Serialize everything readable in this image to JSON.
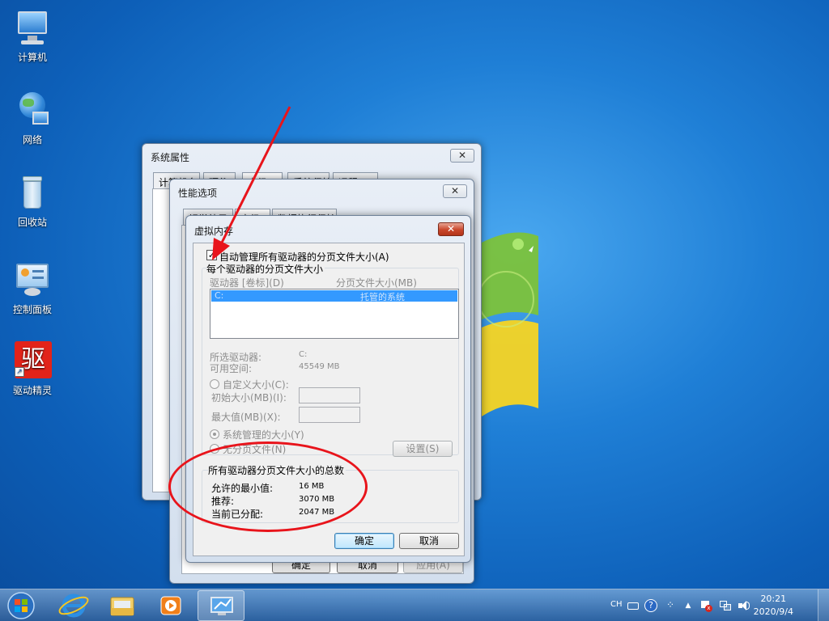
{
  "desktop": {
    "icons": [
      {
        "label": "计算机"
      },
      {
        "label": "网络"
      },
      {
        "label": "回收站"
      },
      {
        "label": "控制面板"
      },
      {
        "label": "驱动精灵",
        "glyph_text": "驱"
      }
    ]
  },
  "system_properties": {
    "title": "系统属性",
    "close": "✕",
    "tabs": [
      "计算机名",
      "硬件",
      "高级",
      "系统保护",
      "远程"
    ],
    "ok": "确定",
    "cancel": "取消",
    "apply": "应用(A)"
  },
  "performance_options": {
    "title": "性能选项",
    "close": "✕",
    "tabs": [
      "视觉效果",
      "高级",
      "数据执行保护"
    ]
  },
  "virtual_memory": {
    "title": "虚拟内存",
    "close": "✕",
    "auto_manage_label": "自动管理所有驱动器的分页文件大小(A)",
    "auto_manage_checked": true,
    "check_glyph": "✓",
    "per_drive_group": "每个驱动器的分页文件大小",
    "col_drive": "驱动器 [卷标](D)",
    "col_size": "分页文件大小(MB)",
    "drive_row": {
      "drive": "C:",
      "size": "托管的系统"
    },
    "selected_drive_label": "所选驱动器:",
    "selected_drive_value": "C:",
    "free_space_label": "可用空间:",
    "free_space_value": "45549 MB",
    "custom_size": "自定义大小(C):",
    "initial_size": "初始大小(MB)(I):",
    "max_size": "最大值(MB)(X):",
    "system_managed": "系统管理的大小(Y)",
    "no_paging": "无分页文件(N)",
    "set_button": "设置(S)",
    "totals_group": "所有驱动器分页文件大小的总数",
    "min_allowed_label": "允许的最小值:",
    "min_allowed_value": "16 MB",
    "recommended_label": "推荐:",
    "recommended_value": "3070 MB",
    "allocated_label": "当前已分配:",
    "allocated_value": "2047 MB",
    "ok": "确定",
    "cancel": "取消"
  },
  "taskbar": {
    "lang": "CH",
    "time": "20:21",
    "date": "2020/9/4"
  },
  "colors": {
    "annotation": "#e8141b",
    "selection": "#3399ff"
  }
}
